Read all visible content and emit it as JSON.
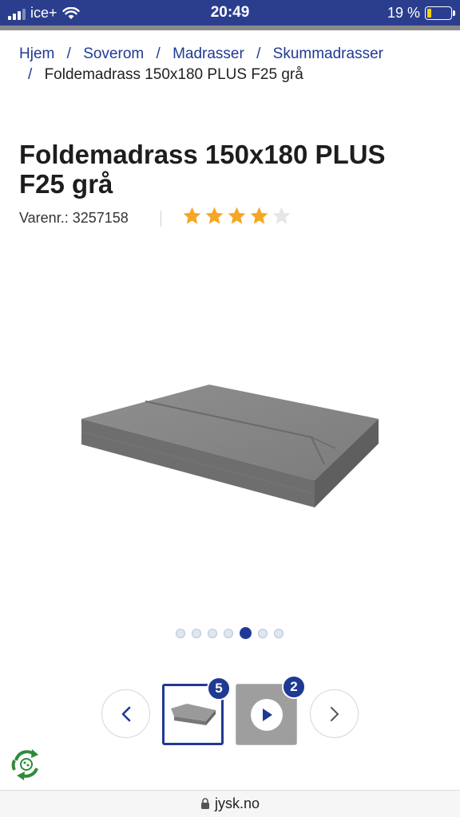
{
  "status_bar": {
    "carrier": "ice+",
    "time": "20:49",
    "battery_text": "19 %",
    "battery_level": 0.19,
    "battery_color": "#f5d20a"
  },
  "breadcrumb": {
    "items": [
      "Hjem",
      "Soverom",
      "Madrasser",
      "Skummadrasser"
    ],
    "current": "Foldemadrass 150x180 PLUS F25 grå",
    "separator": "/"
  },
  "product": {
    "title": "Foldemadrass 150x180 PLUS F25 grå",
    "sku_text": "Varenr.: 3257158",
    "rating": 4,
    "rating_max": 5,
    "star_color": "#f6a623"
  },
  "gallery": {
    "dot_count": 7,
    "active_dot": 5,
    "image_count_badge": "5",
    "video_count_badge": "2",
    "prev_icon": "chevron-left-icon",
    "next_icon": "chevron-right-icon"
  },
  "url_bar": {
    "domain": "jysk.no"
  },
  "colors": {
    "brand_blue": "#1f3a93",
    "status_bar_bg": "#2b3e8e"
  }
}
